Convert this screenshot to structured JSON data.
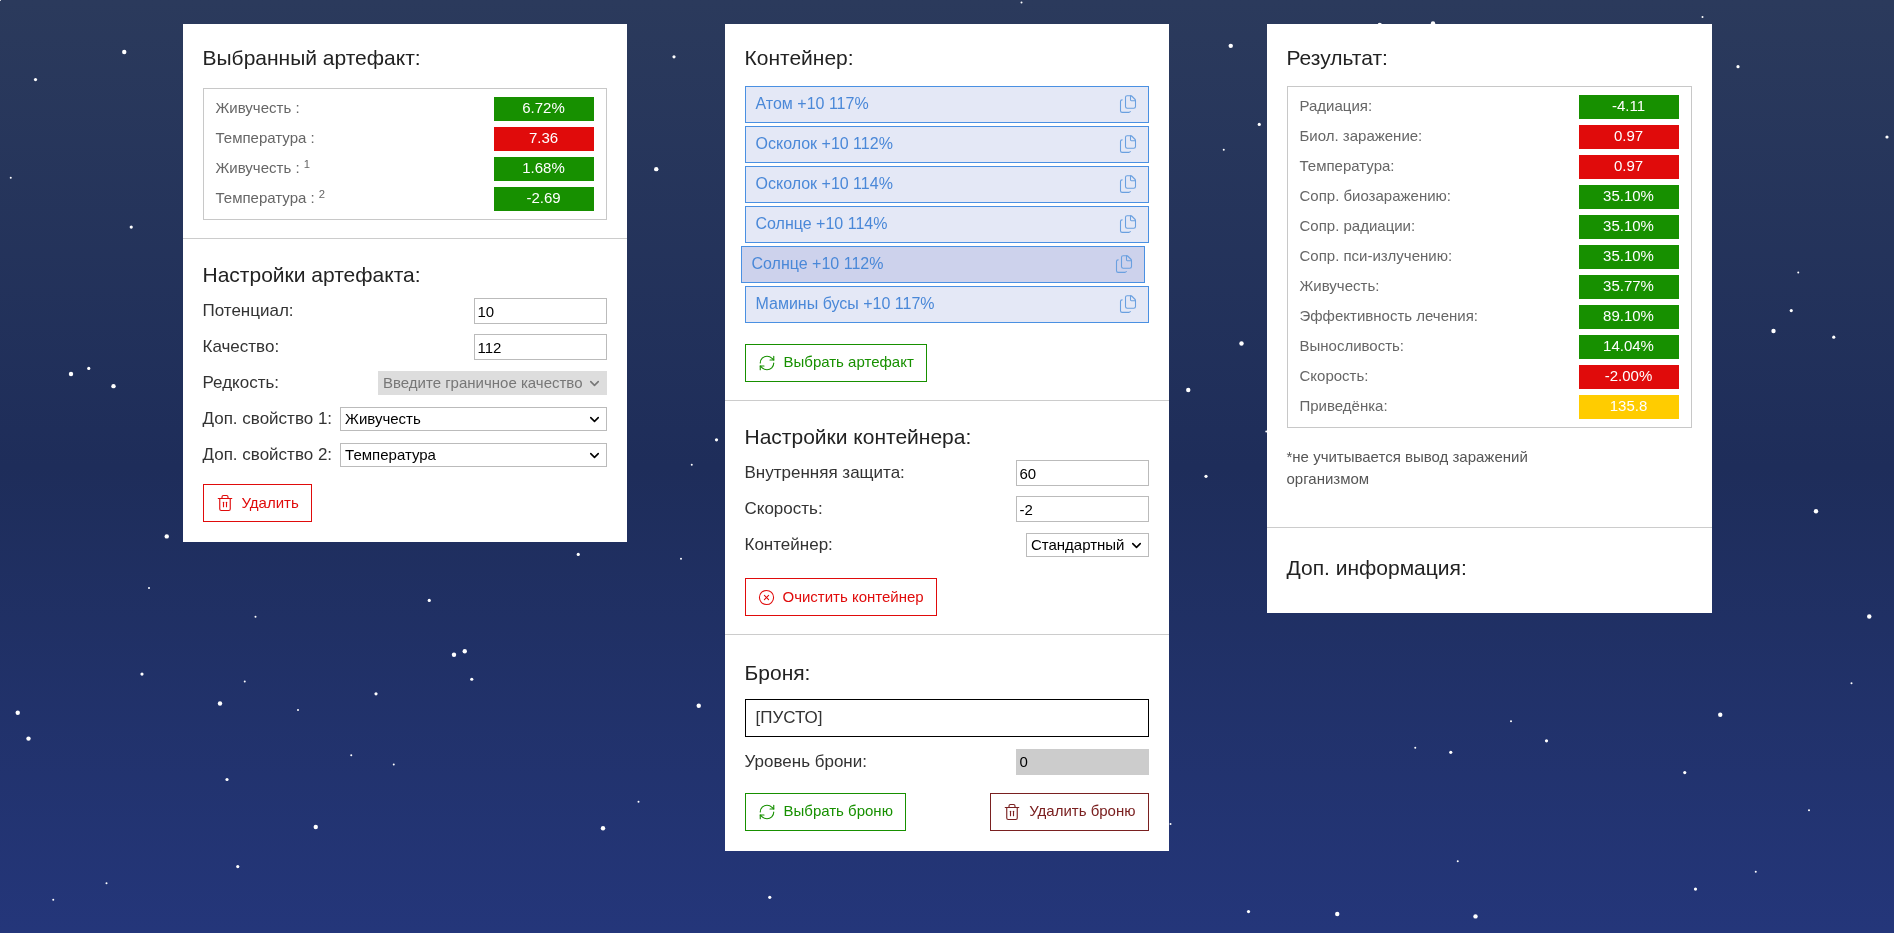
{
  "artifact_panel": {
    "title": "Выбранный артефакт:",
    "stats": [
      {
        "label": "Живучесть :",
        "value": "6.72%",
        "color": "#179000"
      },
      {
        "label": "Температура :",
        "value": "7.36",
        "color": "#e00b0b"
      },
      {
        "label": "Живучесть : $^{1}$",
        "value": "1.68%",
        "color": "#179000"
      },
      {
        "label": "Температура : $^{2}$",
        "value": "-2.69",
        "color": "#179000"
      }
    ],
    "settings_title": "Настройки артефакта:",
    "settings": [
      {
        "label": "Потенциал:",
        "kind": "input",
        "value": "10",
        "disabled": false
      },
      {
        "label": "Качество:",
        "kind": "input",
        "value": "112",
        "disabled": false
      },
      {
        "label": "Редкость:",
        "kind": "select",
        "value": "Введите граничное качество",
        "disabled": true
      },
      {
        "label": "Доп. свойство 1:",
        "kind": "select",
        "value": "Живучесть",
        "disabled": false
      },
      {
        "label": "Доп. свойство 2:",
        "kind": "select",
        "value": "Температура",
        "disabled": false
      }
    ],
    "buttons": [
      {
        "label": "Удалить",
        "kind": "delete"
      }
    ]
  },
  "container_panel": {
    "title": "Контейнер:",
    "items": [
      {
        "label": "Атом +10 117%",
        "selected": false
      },
      {
        "label": "Осколок +10 112%",
        "selected": false
      },
      {
        "label": "Осколок +10 114%",
        "selected": false
      },
      {
        "label": "Солнце +10 114%",
        "selected": false
      },
      {
        "label": "Солнце +10 112%",
        "selected": true
      },
      {
        "label": "Мамины бусы +10 117%",
        "selected": false
      }
    ],
    "buttons": [
      {
        "label": "Выбрать артефакт",
        "kind": "choose"
      }
    ],
    "settings_title": "Настройки контейнера:",
    "settings": [
      {
        "label": "Внутренняя защита:",
        "kind": "input",
        "value": "60",
        "disabled": false
      },
      {
        "label": "Скорость:",
        "kind": "input",
        "value": "-2",
        "disabled": false
      },
      {
        "label": "Контейнер:",
        "kind": "select",
        "value": "Стандартный",
        "disabled": false
      }
    ],
    "settings_buttons": [
      {
        "label": "Очистить контейнер",
        "kind": "clear"
      }
    ],
    "armor_title": "Броня:",
    "armor_value": "[ПУСТО]",
    "armor_settings": [
      {
        "label": "Уровень брони:",
        "kind": "input",
        "value": "0",
        "disabled": true
      }
    ],
    "armor_buttons": [
      {
        "label": "Выбрать броню",
        "kind": "choose"
      },
      {
        "label": "Удалить броню",
        "kind": "remove"
      }
    ]
  },
  "result_panel": {
    "title": "Результат:",
    "stats": [
      {
        "label": "Радиация:",
        "value": "-4.11",
        "color": "#179000"
      },
      {
        "label": "Биол. заражение:",
        "value": "0.97",
        "color": "#e00b0b"
      },
      {
        "label": "Температура:",
        "value": "0.97",
        "color": "#e00b0b"
      },
      {
        "label": "Сопр. биозаражению:",
        "value": "35.10%",
        "color": "#179000"
      },
      {
        "label": "Сопр. радиации:",
        "value": "35.10%",
        "color": "#179000"
      },
      {
        "label": "Сопр. пси-излучению:",
        "value": "35.10%",
        "color": "#179000"
      },
      {
        "label": "Живучесть:",
        "value": "35.77%",
        "color": "#179000"
      },
      {
        "label": "Эффективность лечения:",
        "value": "89.10%",
        "color": "#179000"
      },
      {
        "label": "Выносливость:",
        "value": "14.04%",
        "color": "#179000"
      },
      {
        "label": "Скорость:",
        "value": "-2.00%",
        "color": "#e00b0b"
      },
      {
        "label": "Приведёнка:",
        "value": "135.8",
        "color": "#ffcc00"
      }
    ],
    "note": "*не учитывается вывод заражений организмом",
    "info_title": "Доп. информация:"
  }
}
